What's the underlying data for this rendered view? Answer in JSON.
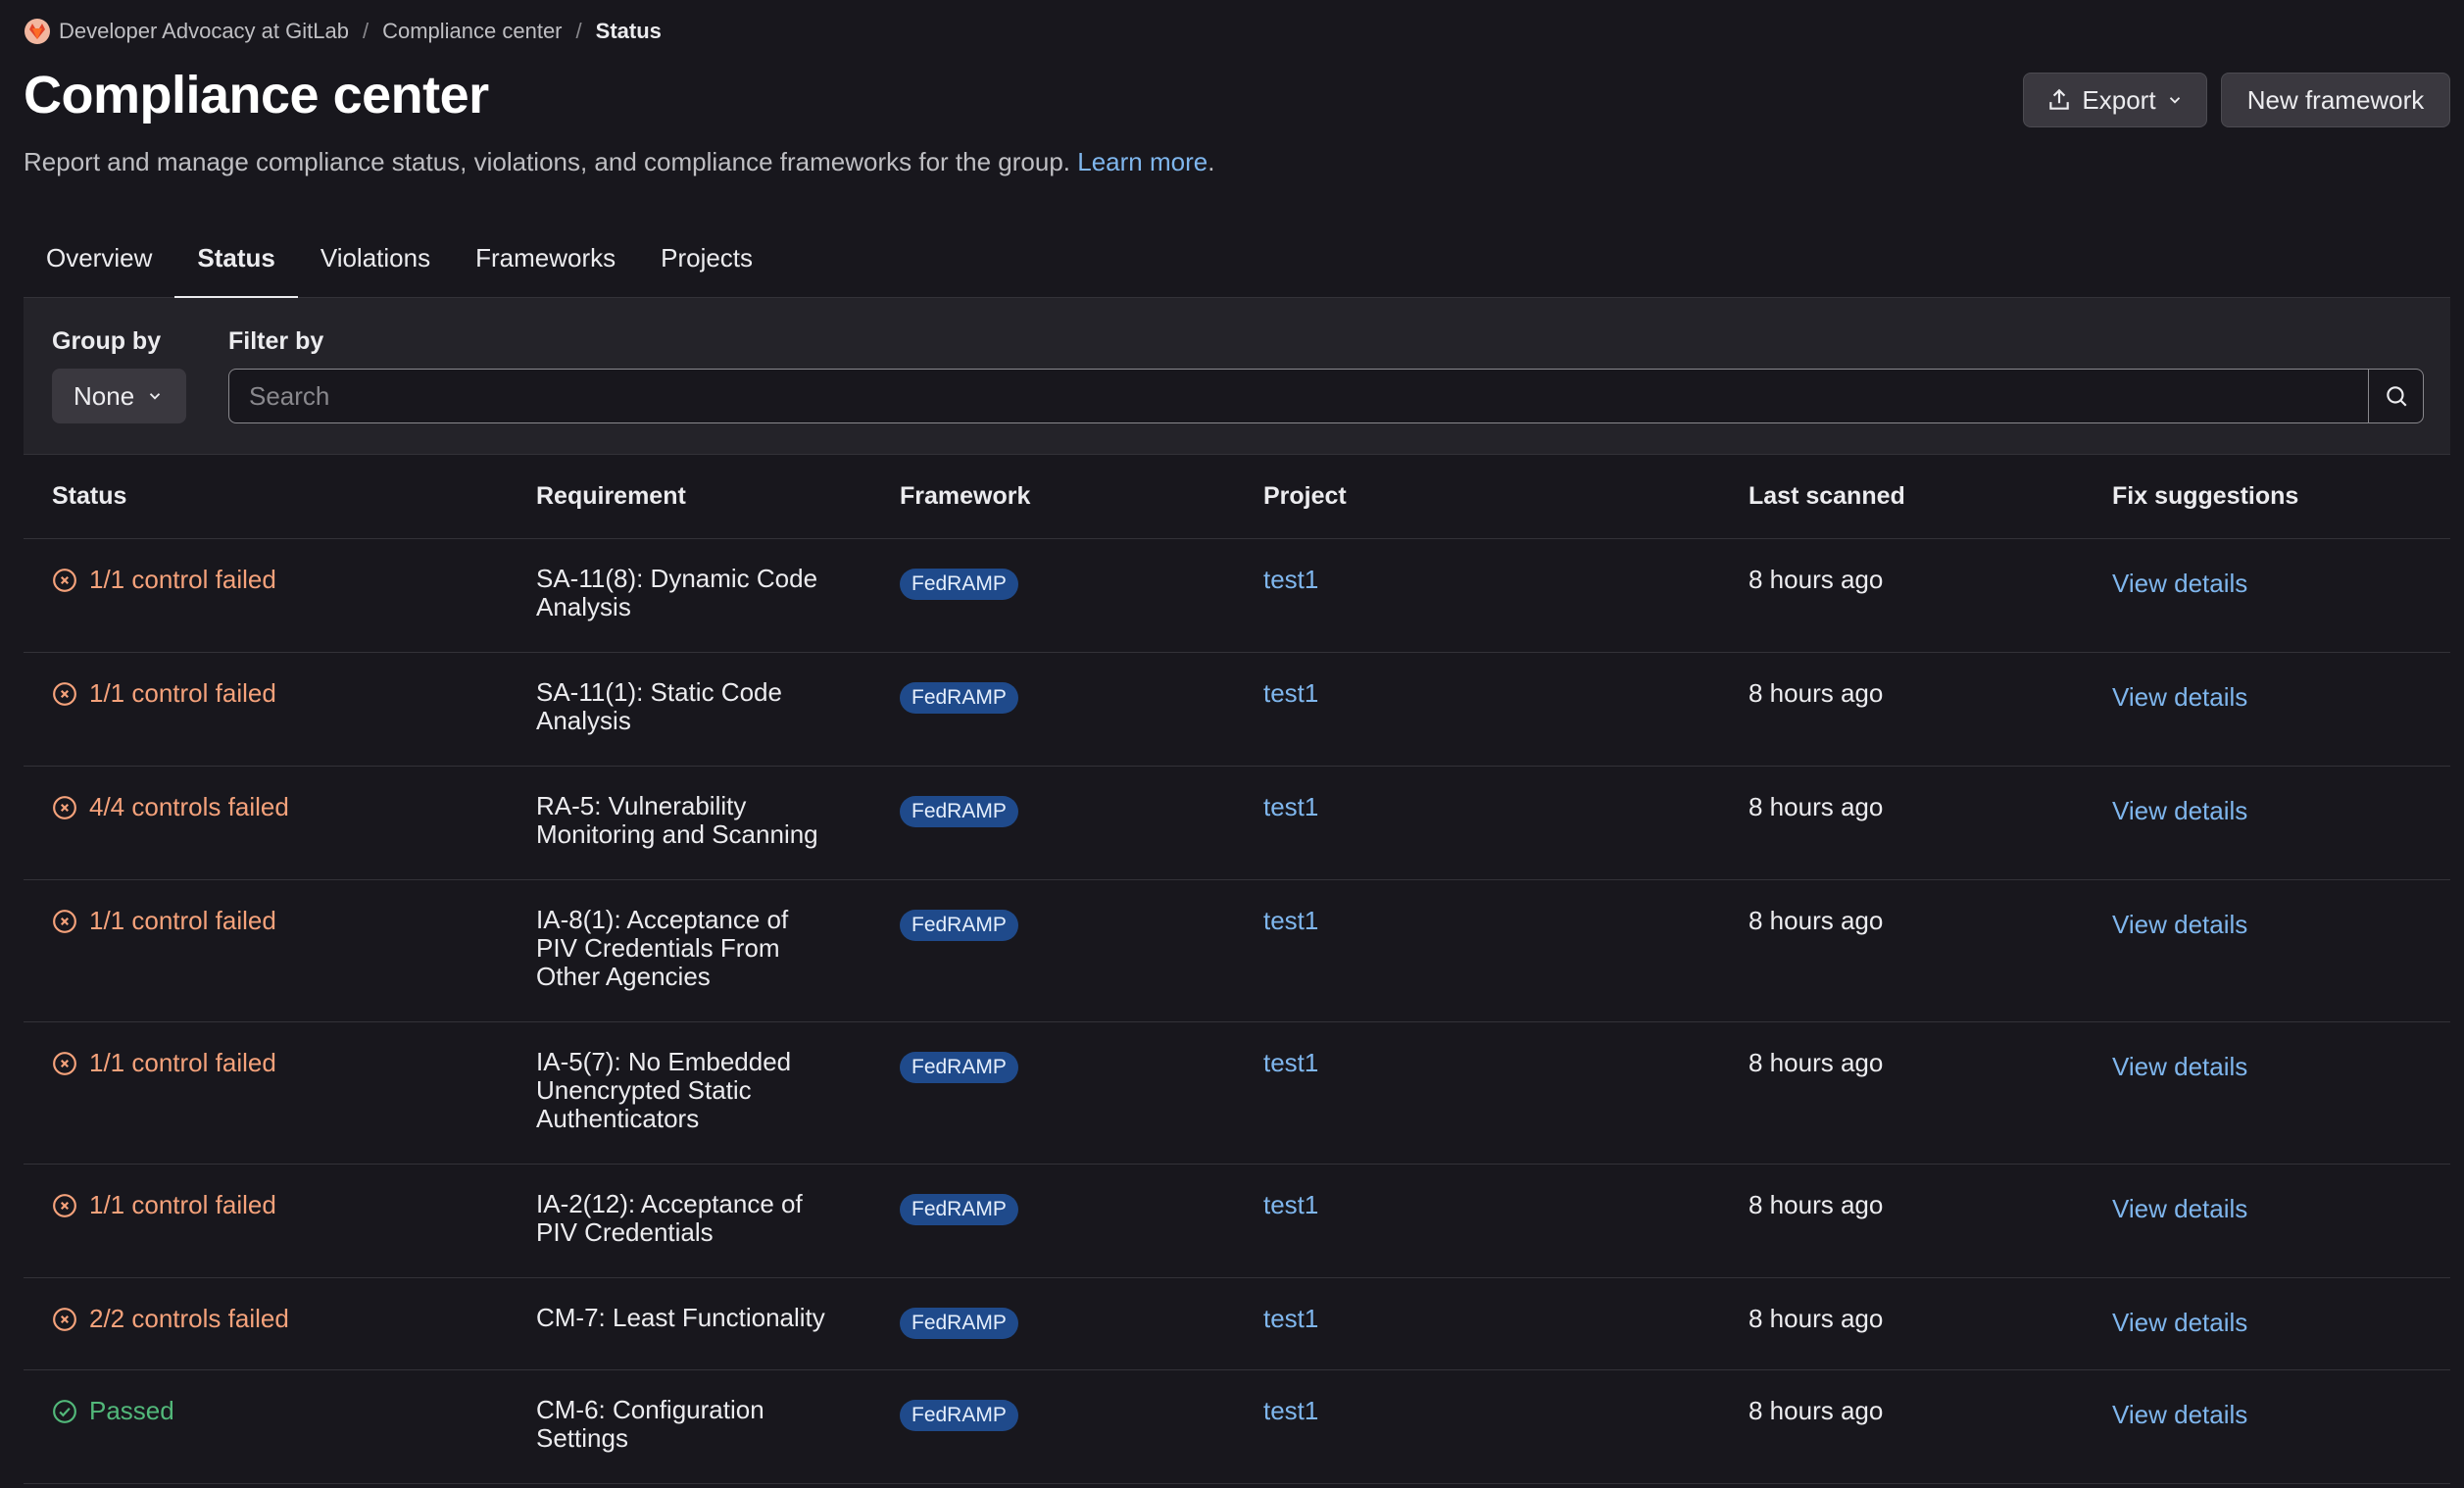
{
  "breadcrumb": {
    "group": "Developer Advocacy at GitLab",
    "section": "Compliance center",
    "current": "Status"
  },
  "header": {
    "title": "Compliance center",
    "description": "Report and manage compliance status, violations, and compliance frameworks for the group.",
    "learn_more": "Learn more",
    "export_label": "Export",
    "new_framework_label": "New framework"
  },
  "tabs": [
    "Overview",
    "Status",
    "Violations",
    "Frameworks",
    "Projects"
  ],
  "active_tab": "Status",
  "filters": {
    "group_by_label": "Group by",
    "group_by_value": "None",
    "filter_by_label": "Filter by",
    "search_placeholder": "Search"
  },
  "table": {
    "headers": [
      "Status",
      "Requirement",
      "Framework",
      "Project",
      "Last scanned",
      "Fix suggestions"
    ],
    "rows": [
      {
        "status": "1/1 control failed",
        "state": "failed",
        "requirement": [
          "SA-11(8): Dynamic Code",
          "Analysis"
        ],
        "framework": "FedRAMP",
        "project": "test1",
        "last_scanned": "8 hours ago",
        "fix": "View details"
      },
      {
        "status": "1/1 control failed",
        "state": "failed",
        "requirement": [
          "SA-11(1): Static Code",
          "Analysis"
        ],
        "framework": "FedRAMP",
        "project": "test1",
        "last_scanned": "8 hours ago",
        "fix": "View details"
      },
      {
        "status": "4/4 controls failed",
        "state": "failed",
        "requirement": [
          "RA-5: Vulnerability",
          "Monitoring and Scanning"
        ],
        "framework": "FedRAMP",
        "project": "test1",
        "last_scanned": "8 hours ago",
        "fix": "View details"
      },
      {
        "status": "1/1 control failed",
        "state": "failed",
        "requirement": [
          "IA-8(1): Acceptance of",
          "PIV Credentials From",
          "Other Agencies"
        ],
        "framework": "FedRAMP",
        "project": "test1",
        "last_scanned": "8 hours ago",
        "fix": "View details"
      },
      {
        "status": "1/1 control failed",
        "state": "failed",
        "requirement": [
          "IA-5(7): No Embedded",
          "Unencrypted Static",
          "Authenticators"
        ],
        "framework": "FedRAMP",
        "project": "test1",
        "last_scanned": "8 hours ago",
        "fix": "View details"
      },
      {
        "status": "1/1 control failed",
        "state": "failed",
        "requirement": [
          "IA-2(12): Acceptance of",
          "PIV Credentials"
        ],
        "framework": "FedRAMP",
        "project": "test1",
        "last_scanned": "8 hours ago",
        "fix": "View details"
      },
      {
        "status": "2/2 controls failed",
        "state": "failed",
        "requirement": [
          "CM-7: Least Functionality"
        ],
        "framework": "FedRAMP",
        "project": "test1",
        "last_scanned": "8 hours ago",
        "fix": "View details"
      },
      {
        "status": "Passed",
        "state": "passed",
        "requirement": [
          "CM-6: Configuration",
          "Settings"
        ],
        "framework": "FedRAMP",
        "project": "test1",
        "last_scanned": "8 hours ago",
        "fix": "View details"
      }
    ]
  },
  "colors": {
    "failed": "#f5a27b",
    "passed": "#52b87a",
    "link": "#7fb6ed",
    "badge": "#1f4a8b"
  }
}
